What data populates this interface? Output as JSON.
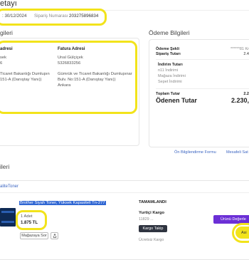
{
  "header": {
    "title": "etayı",
    "order_date": ": 30/12/2024",
    "order_number_label": "Sipariş Numarası :",
    "order_number": "203275896834"
  },
  "addresses": {
    "section_title": "gileri",
    "delivery_title": "adresi",
    "delivery_name": "sek",
    "delivery_phone": "6",
    "delivery_line1": "Ticaret Bakanlığı Dumlupın",
    "delivery_line2": "151-A (Danıştay Yanı))",
    "billing_title": "Fatura Adresi",
    "billing_name": "Unal Gülçiçek",
    "billing_phone": "5326833256",
    "billing_line1": "Gümrük ve Ticaret Bakanlığı Dumlupınar",
    "billing_line2": "Bulv. No:151-A (Danıştay Yanı))",
    "billing_city": "Ankara"
  },
  "payment": {
    "section_title": "Ödeme Bilgileri",
    "method_label": "Ödeme Şekli",
    "method_value": "******81 Kr",
    "subtotal_label": "Sipariş Tutarı",
    "subtotal_value": "2.4",
    "discounts_label": "İndirim Tutarı",
    "discount_1": "n11 İndirimi",
    "discount_2": "Mağaza İndirimi",
    "discount_3": "Sepet İndirimi",
    "total_label": "Toplam Tutar",
    "total_value": "2.2",
    "paid_label": "Ödenen Tutar",
    "paid_value": "2.230,"
  },
  "links": {
    "preinfo": "Ön Bilgilendirme Formu",
    "distance": "Mesafeli Sat"
  },
  "products": {
    "section_title": "ileri",
    "store_name": "aliteToner",
    "product_name": "Brother Siyah Toner, Yüksek Kapasiteli Tn-277",
    "quantity": "1 Adet",
    "price": "1.875 TL",
    "ask_store": "Mağazaya Sor",
    "status": "TAMAMLANDI",
    "cargo_company": "Yurtiçi Kargo",
    "tracking_no": "11829 ...",
    "track_button": "Kargo Takip",
    "shipping_fee": "Ücretsiz Kargo",
    "rate_button": "Ürünü Değerle",
    "help_button": "Asi"
  },
  "colors": {
    "highlight": "#f2e31b",
    "accent_blue": "#3d66c2",
    "purple": "#6b2fd6",
    "dark_button": "#2f3440"
  }
}
